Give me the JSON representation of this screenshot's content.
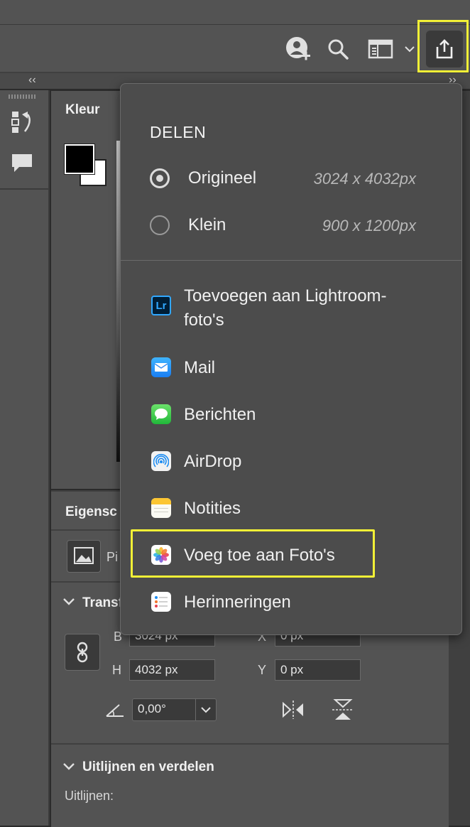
{
  "left_panel": {
    "collapse_glyph": "‹‹"
  },
  "right_panel": {
    "collapse_glyph": "››"
  },
  "color_panel": {
    "tab_label": "Kleur"
  },
  "properties_panel": {
    "tab_label": "Eigensc",
    "layer_type_label": "Pi",
    "transform_section": "Transf",
    "width_label": "B",
    "width_value": "3024 px",
    "height_label": "H",
    "height_value": "4032 px",
    "x_label": "X",
    "x_value": "0 px",
    "y_label": "Y",
    "y_value": "0 px",
    "angle_value": "0,00°",
    "align_section": "Uitlijnen en verdelen",
    "align_label": "Uitlijnen:"
  },
  "share_menu": {
    "title": "DELEN",
    "options": [
      {
        "label": "Origineel",
        "size": "3024 x 4032px",
        "selected": true
      },
      {
        "label": "Klein",
        "size": "900 x 1200px",
        "selected": false
      }
    ],
    "items": [
      {
        "label_line1": "Toevoegen aan Lightroom-",
        "label_line2": "foto's",
        "icon": "lightroom-icon",
        "icon_text": "Lr"
      },
      {
        "label": "Mail",
        "icon": "mail-icon"
      },
      {
        "label": "Berichten",
        "icon": "messages-icon"
      },
      {
        "label": "AirDrop",
        "icon": "airdrop-icon"
      },
      {
        "label": "Notities",
        "icon": "notes-icon"
      },
      {
        "label": "Voeg toe aan Foto's",
        "icon": "photos-icon",
        "highlighted": true
      },
      {
        "label": "Herinneringen",
        "icon": "reminders-icon"
      }
    ]
  },
  "colors": {
    "highlight": "#f2f036",
    "panel": "#535353",
    "menu": "#4c4c4c",
    "lightroom": "#31a8ff"
  }
}
